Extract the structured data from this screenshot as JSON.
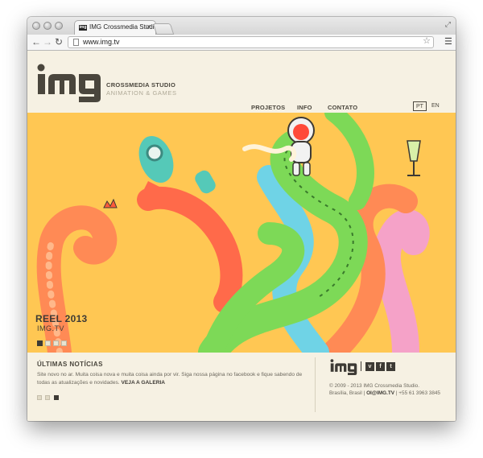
{
  "browser": {
    "tab_title": "IMG Crossmedia Studio",
    "favicon_text": "img",
    "url": "www.img.tv"
  },
  "site": {
    "logo_text": "img",
    "brand_title": "CROSSMEDIA STUDIO",
    "brand_subtitle": "ANIMATION & GAMES",
    "nav": [
      "PROJETOS",
      "INFO",
      "CONTATO"
    ],
    "languages": [
      "PT",
      "EN"
    ],
    "active_language": "PT"
  },
  "hero": {
    "title": "REEL 2013",
    "subtitle": "IMG.TV",
    "slides": 4,
    "active_slide": 1
  },
  "news": {
    "heading": "ÚLTIMAS NOTÍCIAS",
    "body": "Site novo no ar. Muita coisa nova e muita coisa ainda por vir. Siga nossa página no facebook e fique sabendo de todas as atualizações e novidades.",
    "link": "VEJA A GALERIA",
    "slides": 3,
    "active_slide": 3
  },
  "footer": {
    "logo_text": "img",
    "social_icons": [
      "vimeo-icon",
      "facebook-icon",
      "tumblr-icon"
    ],
    "social_glyphs": [
      "v",
      "f",
      "t"
    ],
    "copyright_line": "© 2009 - 2013 IMG Crossmedia Studio.",
    "location": "Brasília, Brasil |",
    "email": "OI@IMG.TV",
    "phone": "| +55 61 3963 3845"
  },
  "colors": {
    "brand_dark": "#4a463d",
    "page_bg": "#f6f1e3",
    "hero_bg": "#ffc753",
    "tentacle_green": "#7dd957",
    "tentacle_blue": "#6fd3e6",
    "tentacle_orange": "#ff8a55",
    "tentacle_pink": "#f5a2c8"
  }
}
